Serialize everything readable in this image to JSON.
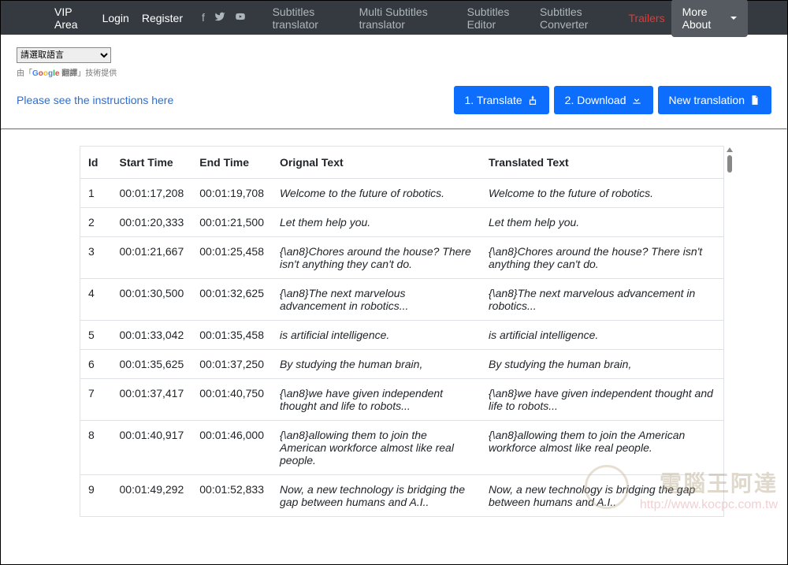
{
  "navbar": {
    "vip": "VIP Area",
    "login": "Login",
    "register": "Register",
    "links": {
      "subtitles_translator": "Subtitles translator",
      "multi_subtitles_translator": "Multi Subtitles translator",
      "subtitles_editor": "Subtitles Editor",
      "subtitles_converter": "Subtitles Converter",
      "trailers": "Trailers"
    },
    "more_about": "More About"
  },
  "google_translate": {
    "select_placeholder": "請選取語言",
    "powered_prefix": "由「",
    "google_chars": [
      "G",
      "o",
      "o",
      "g",
      "l",
      "e"
    ],
    "translate_word": " 翻譯",
    "powered_suffix": "」技術提供"
  },
  "instructions_link": "Please see the instructions here",
  "buttons": {
    "translate": "1. Translate",
    "download": "2. Download",
    "new_translation": "New translation"
  },
  "table": {
    "headers": {
      "id": "Id",
      "start": "Start Time",
      "end": "End Time",
      "original": "Orignal Text",
      "translated": "Translated Text"
    },
    "rows": [
      {
        "id": "1",
        "start": "00:01:17,208",
        "end": "00:01:19,708",
        "orig": "Welcome to the future of robotics.",
        "trans": "Welcome to the future of robotics."
      },
      {
        "id": "2",
        "start": "00:01:20,333",
        "end": "00:01:21,500",
        "orig": "Let them help you.",
        "trans": "Let them help you."
      },
      {
        "id": "3",
        "start": "00:01:21,667",
        "end": "00:01:25,458",
        "orig": "{\\an8}Chores around the house? There isn't anything they can't do.",
        "trans": "{\\an8}Chores around the house? There isn't anything they can't do."
      },
      {
        "id": "4",
        "start": "00:01:30,500",
        "end": "00:01:32,625",
        "orig": "{\\an8}The next marvelous advancement in robotics...",
        "trans": "{\\an8}The next marvelous advancement in robotics..."
      },
      {
        "id": "5",
        "start": "00:01:33,042",
        "end": "00:01:35,458",
        "orig": "is artificial intelligence.",
        "trans": "is artificial intelligence."
      },
      {
        "id": "6",
        "start": "00:01:35,625",
        "end": "00:01:37,250",
        "orig": "By studying the human brain,",
        "trans": "By studying the human brain,"
      },
      {
        "id": "7",
        "start": "00:01:37,417",
        "end": "00:01:40,750",
        "orig": "{\\an8}we have given independent thought and life to robots...",
        "trans": "{\\an8}we have given independent thought and life to robots..."
      },
      {
        "id": "8",
        "start": "00:01:40,917",
        "end": "00:01:46,000",
        "orig": "{\\an8}allowing them to join the American workforce almost like real people.",
        "trans": "{\\an8}allowing them to join the American workforce almost like real people."
      },
      {
        "id": "9",
        "start": "00:01:49,292",
        "end": "00:01:52,833",
        "orig": "Now, a new technology is bridging the gap between humans and A.I..",
        "trans": "Now, a new technology is bridging the gap between humans and A.I.."
      }
    ]
  },
  "watermark": {
    "title": "電腦王阿達",
    "url": "http://www.kocpc.com.tw"
  }
}
